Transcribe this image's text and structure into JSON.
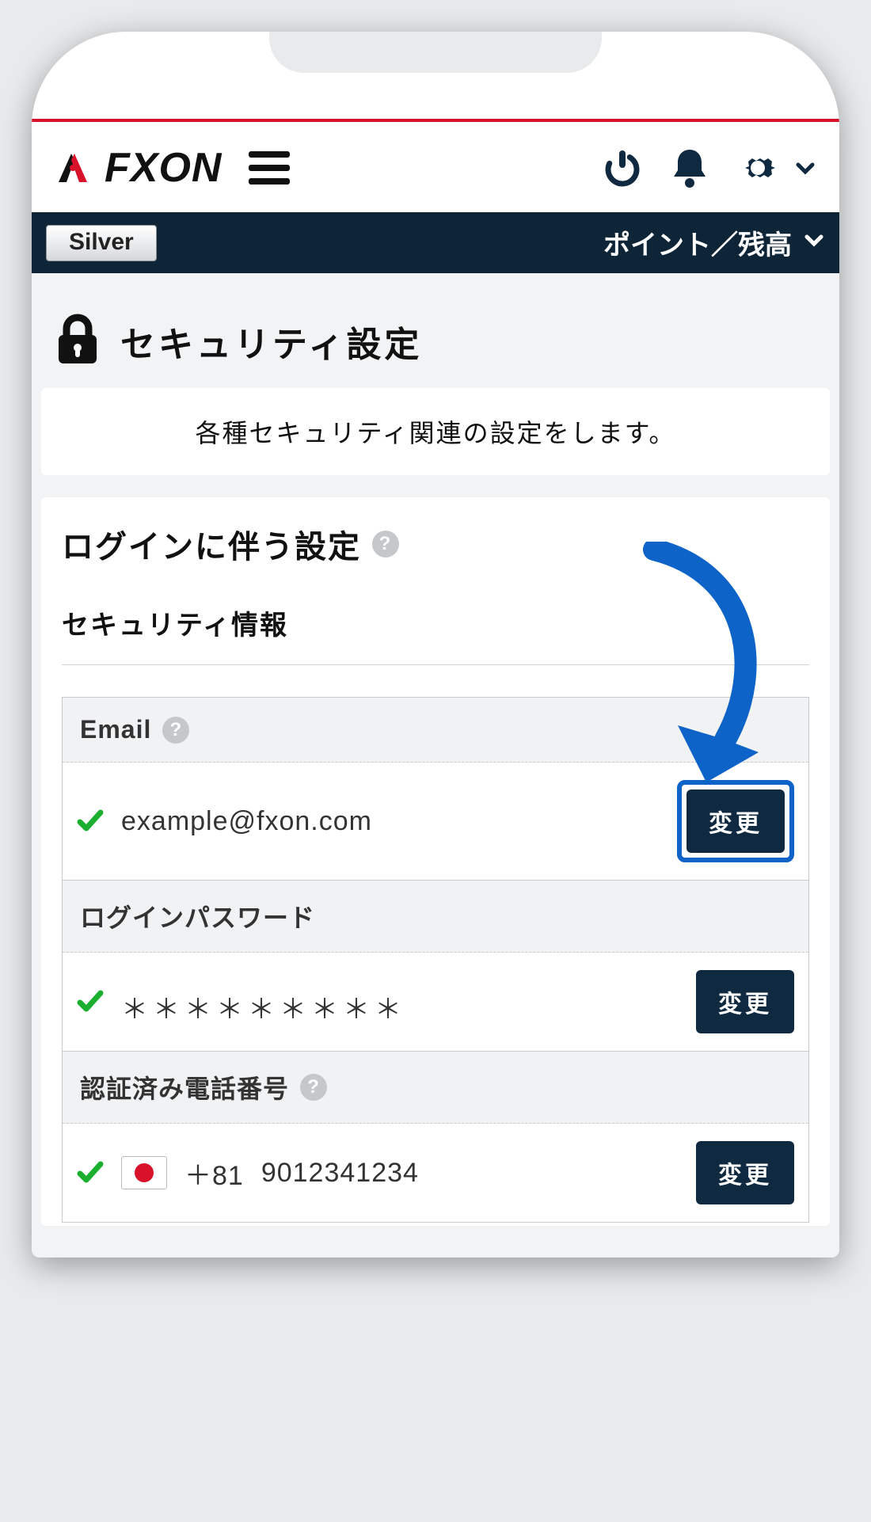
{
  "brand": {
    "name": "FXON"
  },
  "account": {
    "rank": "Silver",
    "balance_label": "ポイント／残高"
  },
  "page": {
    "title": "セキュリティ設定",
    "intro": "各種セキュリティ関連の設定をします。"
  },
  "login_section": {
    "heading": "ログインに伴う設定",
    "subheading": "セキュリティ情報"
  },
  "fields": {
    "email": {
      "label": "Email",
      "value": "example@fxon.com",
      "button": "変更"
    },
    "password": {
      "label": "ログインパスワード",
      "value": "＊＊＊＊＊＊＊＊＊",
      "button": "変更"
    },
    "phone": {
      "label": "認証済み電話番号",
      "country_code": "＋81",
      "number": "9012341234",
      "button": "変更"
    }
  },
  "icons": {
    "lock": "lock-icon",
    "power": "power-icon",
    "bell": "bell-icon",
    "gear": "gear-icon"
  }
}
